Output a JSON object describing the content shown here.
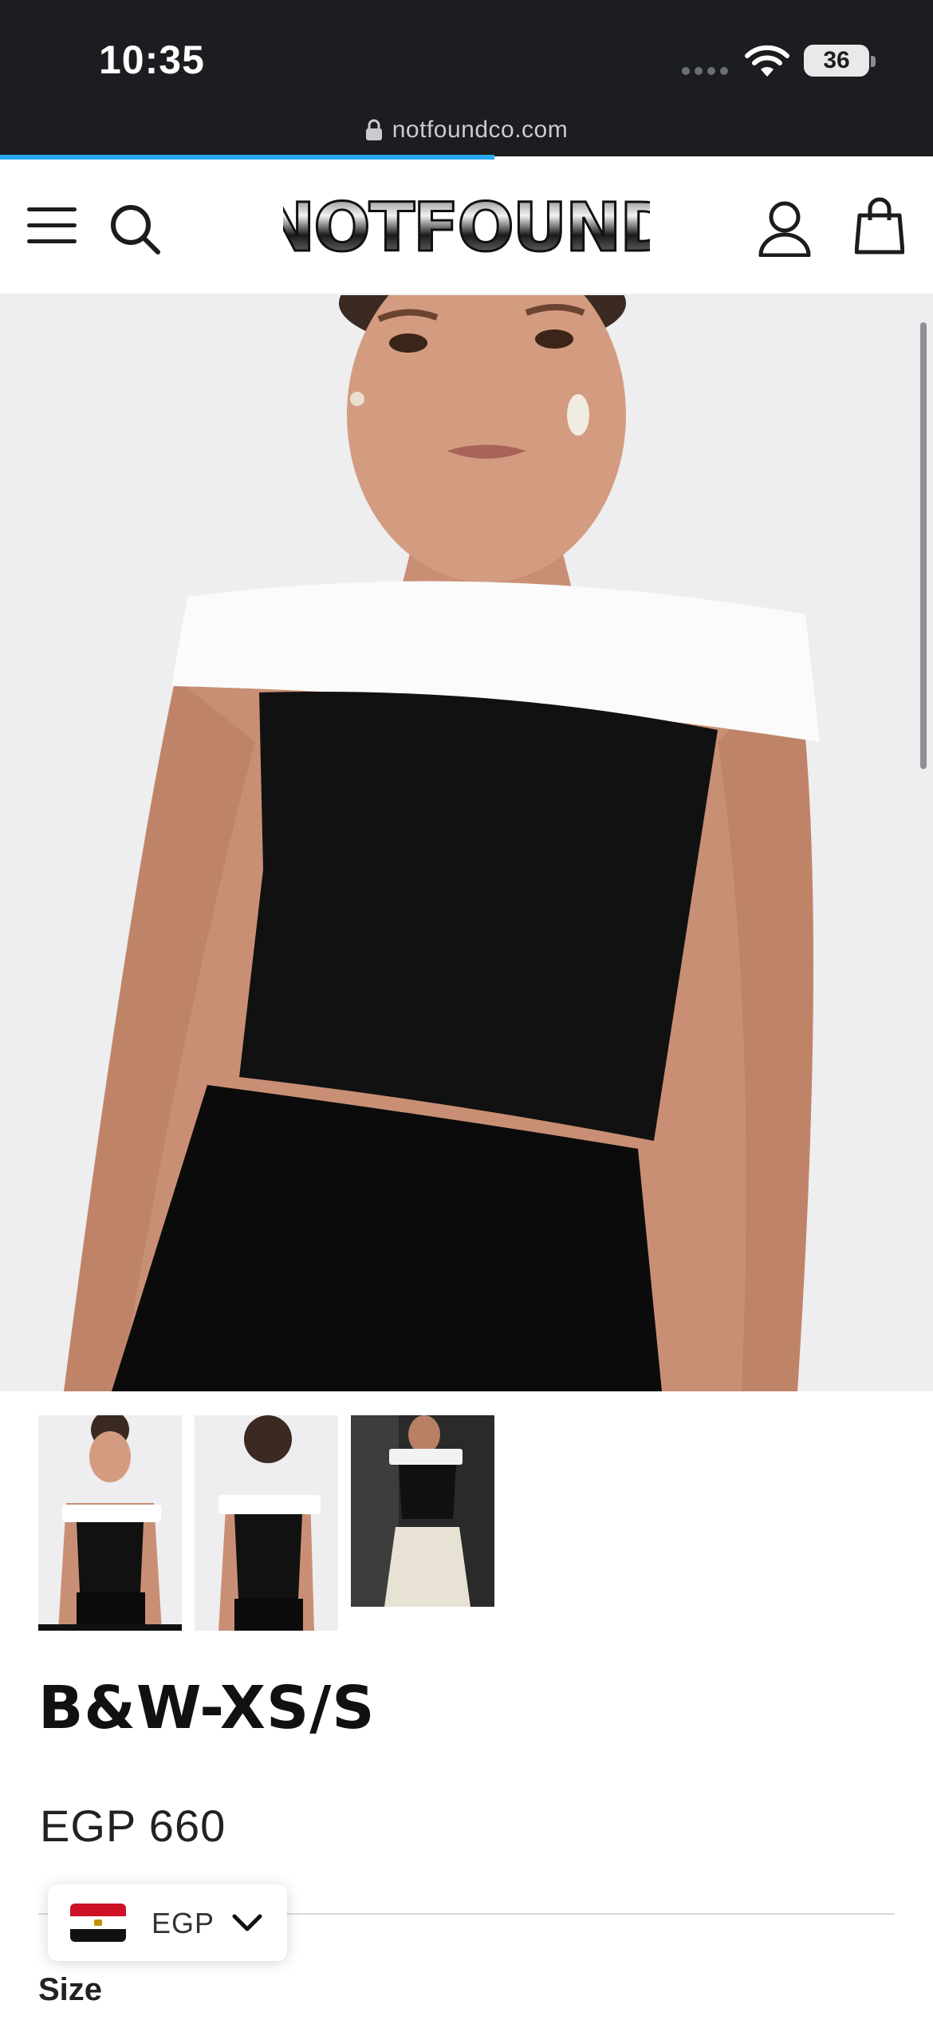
{
  "status_bar": {
    "time": "10:35",
    "battery": "36",
    "url": "notfoundco.com",
    "load_progress": 0.53
  },
  "header": {
    "logo_text": "NOTFOUND"
  },
  "product": {
    "title": "B&W-XS/S",
    "price": "EGP 660",
    "size_label": "Size",
    "thumbnails": [
      "front view",
      "back view",
      "lifestyle"
    ]
  },
  "currency": {
    "code": "EGP"
  },
  "colors": {
    "status_bg": "#1b1d20",
    "progress": "#2aa9f0",
    "text": "#111111"
  }
}
